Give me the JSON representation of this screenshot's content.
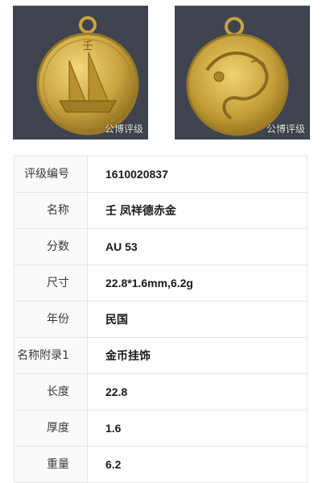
{
  "images": {
    "front_watermark": "公博评级",
    "back_watermark": "公博评级"
  },
  "details": [
    {
      "label": "评级编号",
      "value": "1610020837"
    },
    {
      "label": "名称",
      "value": "壬 凤祥德赤金"
    },
    {
      "label": "分数",
      "value": "AU 53"
    },
    {
      "label": "尺寸",
      "value": "22.8*1.6mm,6.2g"
    },
    {
      "label": "年份",
      "value": "民国"
    },
    {
      "label": "名称附录1",
      "value": "金币挂饰"
    },
    {
      "label": "长度",
      "value": "22.8"
    },
    {
      "label": "厚度",
      "value": "1.6"
    },
    {
      "label": "重量",
      "value": "6.2"
    }
  ],
  "colors": {
    "coin_gold": "#c9a43e",
    "photo_bg": "#3f4450"
  }
}
